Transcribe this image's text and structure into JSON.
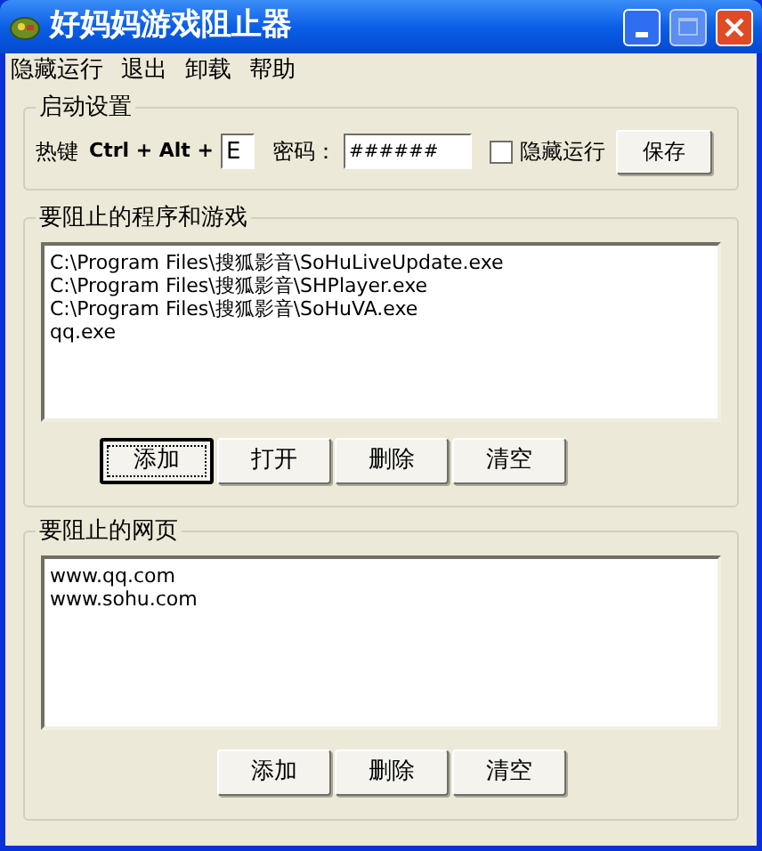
{
  "window": {
    "title": "好妈妈游戏阻止器"
  },
  "menu": [
    {
      "label": "隐藏运行"
    },
    {
      "label": "退出"
    },
    {
      "label": "卸载"
    },
    {
      "label": "帮助"
    }
  ],
  "startup": {
    "title": "启动设置",
    "hotkey_label": "热键",
    "hotkey_combo": "Ctrl + Alt +",
    "hotkey_value": "E",
    "password_label": "密码：",
    "password_value": "######",
    "hide_run": {
      "label": "隐藏运行",
      "checked": false
    },
    "save_button": "保存"
  },
  "programs": {
    "title": "要阻止的程序和游戏",
    "items": [
      "C:\\Program Files\\搜狐影音\\SoHuLiveUpdate.exe",
      "C:\\Program Files\\搜狐影音\\SHPlayer.exe",
      "C:\\Program Files\\搜狐影音\\SoHuVA.exe",
      "qq.exe"
    ],
    "buttons": [
      {
        "label": "添加",
        "focused": true
      },
      {
        "label": "打开",
        "focused": false
      },
      {
        "label": "删除",
        "focused": false
      },
      {
        "label": "清空",
        "focused": false
      }
    ]
  },
  "webpages": {
    "title": "要阻止的网页",
    "items": [
      "www.qq.com",
      "www.sohu.com"
    ],
    "buttons": [
      {
        "label": "添加",
        "focused": false
      },
      {
        "label": "删除",
        "focused": false
      },
      {
        "label": "清空",
        "focused": false
      }
    ]
  }
}
